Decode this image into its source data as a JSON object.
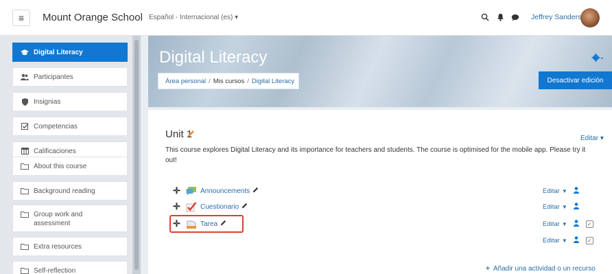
{
  "navbar": {
    "site_name": "Mount Orange School",
    "language": "Español - Internacional (es) ▾",
    "user_name": "Jeffrey Sanders"
  },
  "sidebar": {
    "items": [
      {
        "label": "Digital Literacy",
        "icon": "graduation-cap-icon",
        "glyph": "🎓",
        "active": true
      },
      {
        "label": "Participantes",
        "icon": "users-icon",
        "glyph": "👥",
        "active": false
      },
      {
        "label": "Insignias",
        "icon": "shield-icon",
        "glyph": "⛉",
        "active": false
      },
      {
        "label": "Competencias",
        "icon": "checked-box-icon",
        "glyph": "☑",
        "active": false
      },
      {
        "label": "Calificaciones",
        "icon": "table-icon",
        "glyph": "▦",
        "active": false
      },
      {
        "label": "About this course",
        "icon": "folder-icon",
        "glyph": "▭",
        "active": false
      },
      {
        "label": "Background reading",
        "icon": "folder-icon",
        "glyph": "▭",
        "active": false
      },
      {
        "label_line1": "Group work and",
        "label_line2": "assessment",
        "icon": "folder-icon",
        "glyph": "▭",
        "active": false
      },
      {
        "label": "Extra resources",
        "icon": "folder-icon",
        "glyph": "▭",
        "active": false
      },
      {
        "label": "Self-reflection",
        "icon": "folder-icon",
        "glyph": "▭",
        "active": false
      }
    ]
  },
  "header": {
    "title": "Digital Literacy",
    "breadcrumb": [
      "Área personal",
      "Mis cursos",
      "Digital Literacy"
    ],
    "edit_button": "Desactivar edición"
  },
  "section": {
    "title": "Unit 1",
    "edit_menu": "Editar ▾",
    "summary": "This course explores Digital Literacy and its importance for teachers and students. The course is optimised for the mobile app. Please try it out!",
    "activities": [
      {
        "name": "Announcements",
        "icon": "forum-icon"
      },
      {
        "name": "Cuestionario",
        "icon": "quiz-icon"
      },
      {
        "name": "Tarea",
        "icon": "assignment-icon",
        "highlighted": true
      }
    ],
    "row_edit_label": "Editar",
    "add_activity": "Añadir una actividad o un recurso"
  },
  "colors": {
    "accent": "#1177d1",
    "link": "#2a6ea6",
    "highlight_border": "#d8412f",
    "pencil_orange": "#f38a1f"
  }
}
